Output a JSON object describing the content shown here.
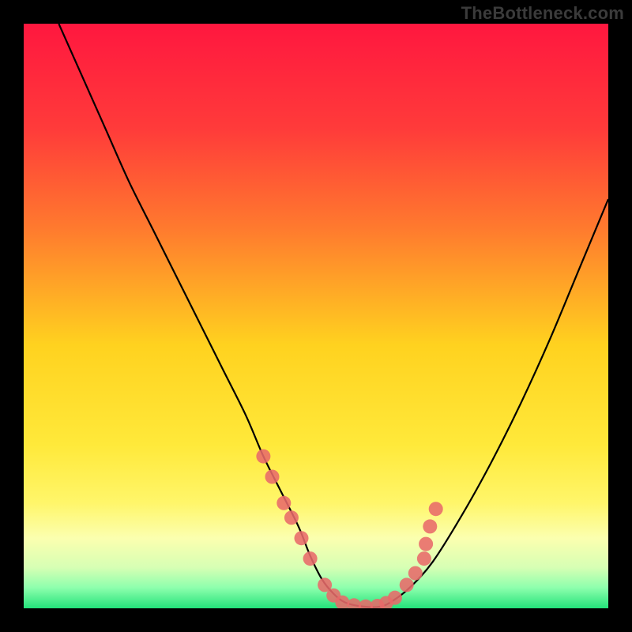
{
  "watermark": "TheBottleneck.com",
  "chart_data": {
    "type": "line",
    "title": "",
    "xlabel": "",
    "ylabel": "",
    "xlim": [
      0,
      100
    ],
    "ylim": [
      0,
      100
    ],
    "grid": false,
    "legend": false,
    "background": {
      "type": "vertical-gradient",
      "stops": [
        {
          "pos": 0.0,
          "color": "#ff173f"
        },
        {
          "pos": 0.18,
          "color": "#ff3b3a"
        },
        {
          "pos": 0.35,
          "color": "#ff7a2e"
        },
        {
          "pos": 0.55,
          "color": "#ffd21f"
        },
        {
          "pos": 0.72,
          "color": "#ffe93a"
        },
        {
          "pos": 0.82,
          "color": "#fff66a"
        },
        {
          "pos": 0.88,
          "color": "#fbffaf"
        },
        {
          "pos": 0.93,
          "color": "#d7ffb4"
        },
        {
          "pos": 0.965,
          "color": "#8dffad"
        },
        {
          "pos": 1.0,
          "color": "#23e27a"
        }
      ]
    },
    "series": [
      {
        "name": "bottleneck-curve",
        "color": "#000000",
        "stroke_width": 2.2,
        "x": [
          6,
          10,
          14,
          18,
          22,
          26,
          30,
          34,
          38,
          41,
          44,
          47,
          49,
          51,
          53,
          55,
          58,
          61,
          63,
          66,
          70,
          75,
          80,
          85,
          90,
          95,
          100
        ],
        "y": [
          100,
          91,
          82,
          73,
          65,
          57,
          49,
          41,
          33,
          26,
          20,
          14,
          9,
          5,
          2.5,
          1,
          0.3,
          0.3,
          1.2,
          3.5,
          8,
          16,
          25,
          35,
          46,
          58,
          70
        ]
      }
    ],
    "marker_clusters": [
      {
        "name": "left-cluster",
        "color": "#e86a6a",
        "radius": 9,
        "points": [
          {
            "x": 41.0,
            "y": 26.0
          },
          {
            "x": 42.5,
            "y": 22.5
          },
          {
            "x": 44.5,
            "y": 18.0
          },
          {
            "x": 45.8,
            "y": 15.5
          },
          {
            "x": 47.5,
            "y": 12.0
          },
          {
            "x": 49.0,
            "y": 8.5
          }
        ]
      },
      {
        "name": "bottom-cluster",
        "color": "#e86a6a",
        "radius": 9,
        "points": [
          {
            "x": 51.5,
            "y": 4.0
          },
          {
            "x": 53.0,
            "y": 2.2
          },
          {
            "x": 54.5,
            "y": 1.0
          },
          {
            "x": 56.5,
            "y": 0.5
          },
          {
            "x": 58.5,
            "y": 0.3
          },
          {
            "x": 60.5,
            "y": 0.4
          },
          {
            "x": 62.0,
            "y": 0.9
          },
          {
            "x": 63.5,
            "y": 1.8
          }
        ]
      },
      {
        "name": "right-cluster",
        "color": "#e86a6a",
        "radius": 9,
        "points": [
          {
            "x": 65.5,
            "y": 4.0
          },
          {
            "x": 67.0,
            "y": 6.0
          },
          {
            "x": 68.5,
            "y": 8.5
          },
          {
            "x": 68.8,
            "y": 11.0
          },
          {
            "x": 69.5,
            "y": 14.0
          },
          {
            "x": 70.5,
            "y": 17.0
          }
        ]
      }
    ]
  }
}
